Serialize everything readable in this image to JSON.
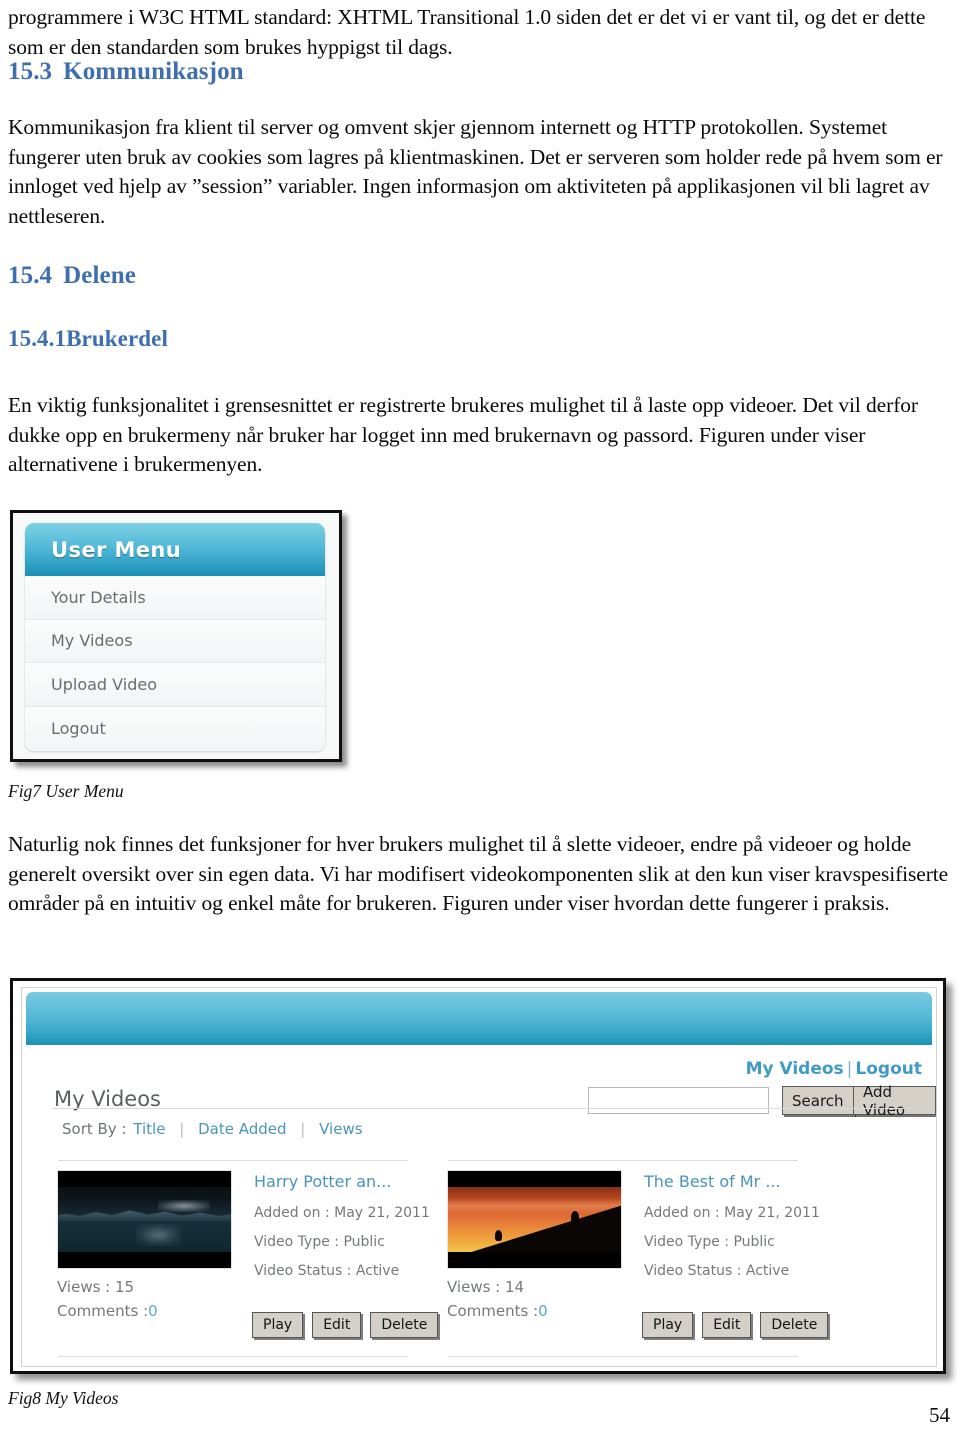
{
  "document": {
    "page_number": "54",
    "intro_paragraph": "programmere i W3C HTML standard: XHTML Transitional 1.0 siden det er det vi er vant til, og det er dette som er den standarden som brukes hyppigst til dags.",
    "section_153": {
      "number": "15.3",
      "title": "Kommunikasjon",
      "body": "Kommunikasjon fra klient til server og omvent skjer gjennom internett og HTTP protokollen. Systemet fungerer uten bruk av cookies som lagres på klientmaskinen. Det er serveren som holder rede på hvem som er innloget ved hjelp av ”session” variabler. Ingen informasjon om aktiviteten på applikasjonen vil bli lagret av nettleseren."
    },
    "section_154": {
      "number": "15.4",
      "title": "Delene"
    },
    "section_1541": {
      "number": "15.4.1",
      "title": "Brukerdel",
      "body": "En viktig funksjonalitet i grensesnittet er registrerte brukeres mulighet til å laste opp videoer. Det vil derfor dukke opp en brukermeny når bruker har logget inn med brukernavn og passord. Figuren under viser alternativene i brukermenyen."
    },
    "paragraph_after_fig7": "Naturlig nok finnes det funksjoner for hver brukers mulighet til å slette videoer, endre på videoer og holde generelt oversikt over sin egen data. Vi har modifisert videokomponenten slik at den kun viser kravspesifiserte områder på en intuitiv og enkel måte for brukeren. Figuren under viser hvordan dette fungerer i praksis.",
    "fig7_caption": "Fig7 User Menu",
    "fig8_caption": "Fig8 My Videos"
  },
  "colors": {
    "heading_blue": "#3d6fae",
    "banner_blue_top": "#79cadf",
    "banner_blue_bottom": "#1c90b7",
    "link_blue": "#4a93bd",
    "accent_bold_blue": "#3f9ac7",
    "button_face": "#d4d0c8",
    "muted_text": "#75797c"
  },
  "fig7_user_menu": {
    "header_title": "User Menu",
    "items": [
      {
        "label": "Your Details"
      },
      {
        "label": "My Videos"
      },
      {
        "label": "Upload Video"
      },
      {
        "label": "Logout"
      }
    ]
  },
  "fig8_my_videos": {
    "account_links": {
      "my_videos": "My Videos",
      "separator": "|",
      "logout": "Logout"
    },
    "page_title": "My Videos",
    "search": {
      "value": "",
      "placeholder": "",
      "search_button": "Search",
      "add_video_button": "Add Video"
    },
    "sort": {
      "label": "Sort By :",
      "options": [
        "Title",
        "Date Added",
        "Views"
      ],
      "separator": "|"
    },
    "cards": [
      {
        "title": "Harry Potter an...",
        "added_on": "Added on : May 21, 2011",
        "video_type": "Video Type : Public",
        "video_status": "Video Status : Active",
        "views_label": "Views : 15",
        "comments_label": "Comments :",
        "comments_count": "0",
        "thumbnail": "night-lake-mountains-thumbnail",
        "actions": [
          "Play",
          "Edit",
          "Delete"
        ]
      },
      {
        "title": "The Best of Mr ...",
        "added_on": "Added on : May 21, 2011",
        "video_type": "Video Type : Public",
        "video_status": "Video Status : Active",
        "views_label": "Views : 14",
        "comments_label": "Comments :",
        "comments_count": "0",
        "thumbnail": "sunset-hillside-thumbnail",
        "actions": [
          "Play",
          "Edit",
          "Delete"
        ]
      }
    ]
  }
}
